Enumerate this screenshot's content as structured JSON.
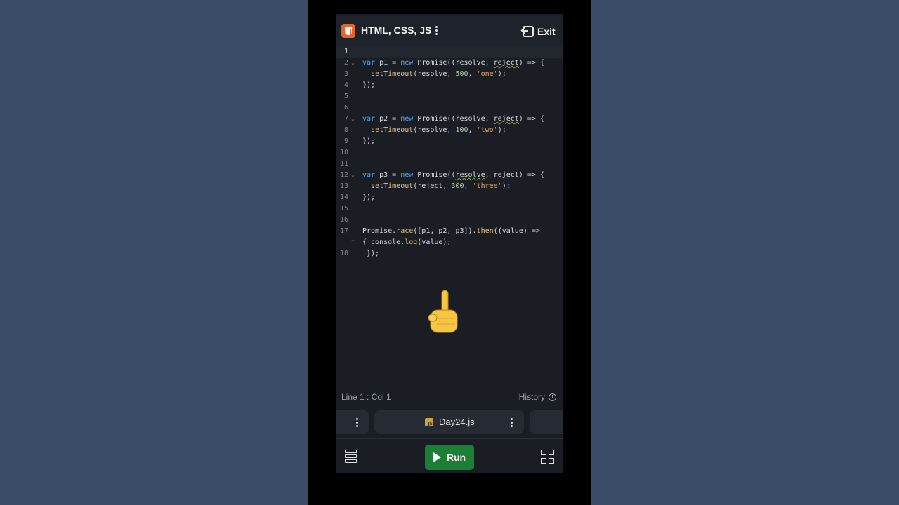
{
  "app": {
    "title": "HTML, CSS, JS",
    "logo_icon": "html5-icon",
    "exit_label": "Exit"
  },
  "editor": {
    "lines": [
      {
        "n": "1",
        "text": ""
      },
      {
        "n": "2",
        "text": "var p1 = new Promise((resolve, reject) => {"
      },
      {
        "n": "3",
        "text": "  setTimeout(resolve, 500, 'one');"
      },
      {
        "n": "4",
        "text": "});"
      },
      {
        "n": "5",
        "text": ""
      },
      {
        "n": "6",
        "text": ""
      },
      {
        "n": "7",
        "text": "var p2 = new Promise((resolve, reject) => {"
      },
      {
        "n": "8",
        "text": "  setTimeout(resolve, 100, 'two');"
      },
      {
        "n": "9",
        "text": "});"
      },
      {
        "n": "10",
        "text": ""
      },
      {
        "n": "11",
        "text": ""
      },
      {
        "n": "12",
        "text": "var p3 = new Promise((resolve, reject) => {"
      },
      {
        "n": "13",
        "text": "  setTimeout(reject, 300, 'three');"
      },
      {
        "n": "14",
        "text": "});"
      },
      {
        "n": "15",
        "text": ""
      },
      {
        "n": "16",
        "text": ""
      },
      {
        "n": "17",
        "text": "Promise.race([p1, p2, p3]).then((value) =>"
      },
      {
        "n": "",
        "text": "{ console.log(value);"
      },
      {
        "n": "18",
        "text": " });"
      }
    ]
  },
  "status": {
    "position": "Line 1 : Col 1",
    "history_label": "History"
  },
  "tab": {
    "filename": "Day24.js",
    "file_icon_text": "JS"
  },
  "toolbar": {
    "run_label": "Run"
  },
  "colors": {
    "run_green": "#1b7f35",
    "background": "#1a1d24",
    "keyword": "#5aa6e6"
  }
}
